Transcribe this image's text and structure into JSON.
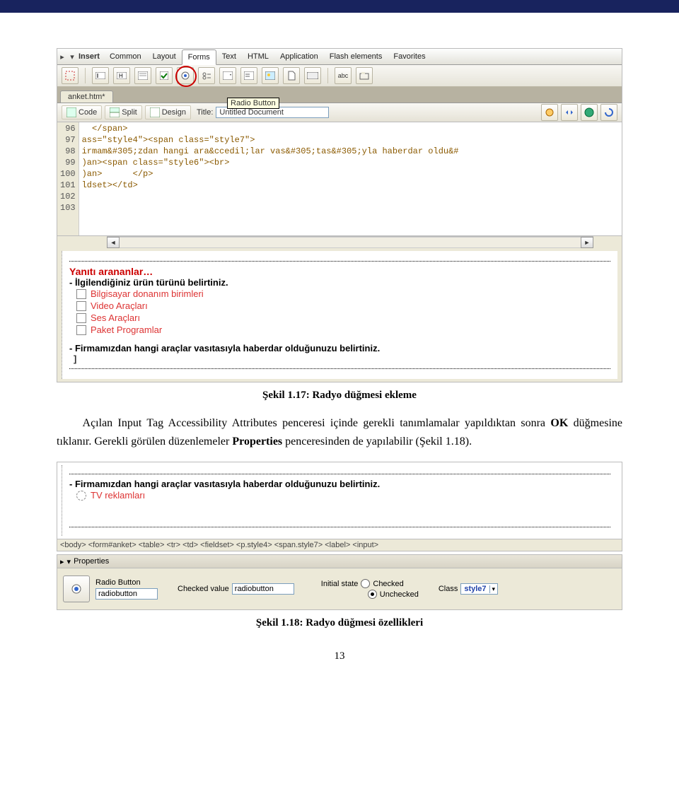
{
  "figure1": {
    "insert_label": "Insert",
    "tabs": [
      "Common",
      "Layout",
      "Forms",
      "Text",
      "HTML",
      "Application",
      "Flash elements",
      "Favorites"
    ],
    "active_tab": 2,
    "tooltip": "Radio Button",
    "doc_tab": "anket.htm*",
    "view": {
      "code": "Code",
      "split": "Split",
      "design": "Design",
      "title_lbl": "Title:",
      "title_val": "Untitled Document"
    },
    "code": {
      "lines": [
        {
          "n": "96",
          "t": "  </span>"
        },
        {
          "n": "97",
          "t": "ass=\"style4\"><span class=\"style7\">"
        },
        {
          "n": "98",
          "t": "irmam&#305;zdan hangi ara&ccedil;lar vas&#305;tas&#305;yla haberdar oldu&#"
        },
        {
          "n": "99",
          "t": ")an><span class=\"style6\"><br>"
        },
        {
          "n": "100",
          "t": ")an>      </p>"
        },
        {
          "n": "101",
          "t": "ldset></td>"
        },
        {
          "n": "102",
          "t": ""
        },
        {
          "n": "103",
          "t": ""
        }
      ]
    },
    "preview": {
      "heading": "Yanıtı arananlar…",
      "q1": "- İlgilendiğiniz ürün türünü belirtiniz.",
      "opts": [
        "Bilgisayar donanım birimleri",
        "Video Araçları",
        "Ses Araçları",
        "Paket Programlar"
      ],
      "q2": "- Firmamızdan hangi araçlar vasıtasıyla haberdar olduğunuzu belirtiniz."
    }
  },
  "caption1": "Şekil 1.17: Radyo düğmesi ekleme",
  "para": {
    "p1a": "Açılan Input Tag Accessibility Attributes penceresi içinde gerekli tanımlamalar yapıldıktan sonra ",
    "p1b": "OK",
    "p1c": " düğmesine tıklanır. Gerekli görülen düzenlemeler ",
    "p1d": "Properties",
    "p1e": " penceresinden de yapılabilir (Şekil 1.18)."
  },
  "figure2": {
    "q": "- Firmamızdan hangi araçlar vasıtasıyla haberdar olduğunuzu belirtiniz.",
    "opt": "TV reklamları",
    "trail": "<body> <form#anket> <table> <tr> <td> <fieldset> <p.style4> <span.style7> <label> <input>",
    "props_label": "Properties",
    "row1": {
      "name_lbl": "Radio Button",
      "cv_lbl": "Checked value",
      "cv_val": "radiobutton",
      "is_lbl": "Initial state",
      "checked": "Checked",
      "class_lbl": "Class",
      "class_val": "style7"
    },
    "row2": {
      "name_val": "radiobutton",
      "unchecked": "Unchecked"
    }
  },
  "caption2": "Şekil 1.18: Radyo düğmesi özellikleri",
  "pageno": "13"
}
